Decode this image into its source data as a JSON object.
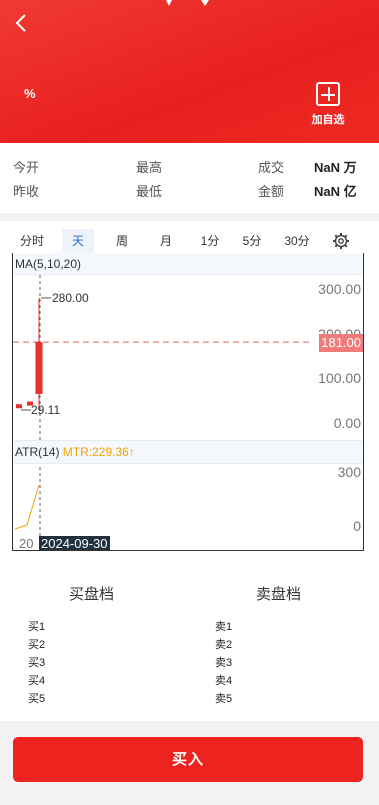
{
  "header": {
    "percent": "%",
    "favorite_label": "加自选",
    "accent": "#ee2320"
  },
  "stats": {
    "open_label": "今开",
    "prev_close_label": "昨收",
    "high_label": "最高",
    "low_label": "最低",
    "volume_label": "成交",
    "amount_label": "金额",
    "volume_value": "NaN 万",
    "amount_value": "NaN 亿"
  },
  "chart_tabs": [
    "分时",
    "天",
    "周",
    "月",
    "1分",
    "5分",
    "30分"
  ],
  "active_tab": "天",
  "indicators": {
    "ma_label": "MA(5,10,20)",
    "atr_label": "ATR(14)",
    "mtr_label": "MTR:229.36↑"
  },
  "chart_data": {
    "type": "candlestick",
    "y_ticks": [
      "300.00",
      "200.00",
      "100.00",
      "0.00"
    ],
    "ylim": [
      0,
      320
    ],
    "current_price_label": "181.00",
    "current_price": 181,
    "max_label": "280.00",
    "min_label": "29.11",
    "candles": [
      {
        "open": 42,
        "close": 38,
        "high": 42,
        "low": 38,
        "dir": "down"
      },
      {
        "open": 48,
        "close": 44,
        "high": 48,
        "low": 44,
        "dir": "down"
      },
      {
        "open": 65,
        "close": 181,
        "high": 280,
        "low": 29.11,
        "dir": "up"
      }
    ],
    "atr_ticks": [
      "300",
      "0"
    ],
    "atr_ylim": [
      0,
      320
    ],
    "atr_values": [
      10,
      30,
      229.36
    ],
    "x_date_label": "2024-09-30",
    "x_year_label": "20"
  },
  "order_book": {
    "buy_title": "买盘档",
    "sell_title": "卖盘档",
    "buy_levels": [
      "买1",
      "买2",
      "买3",
      "买4",
      "买5"
    ],
    "sell_levels": [
      "卖1",
      "卖2",
      "卖3",
      "卖4",
      "卖5"
    ]
  },
  "buy_button": "买入"
}
